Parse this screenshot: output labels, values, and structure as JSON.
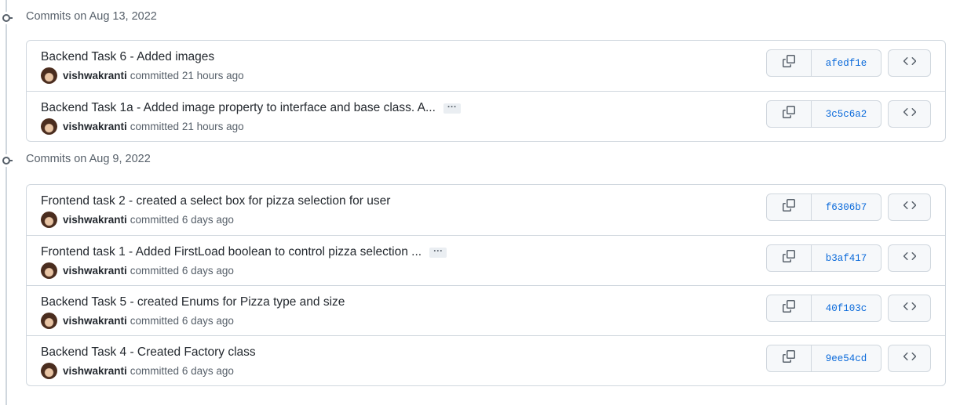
{
  "groups": [
    {
      "title": "Commits on Aug 13, 2022",
      "commits": [
        {
          "message": "Backend Task 6 - Added images",
          "truncated": false,
          "author": "vishwakranti",
          "committed_text": "committed 21 hours ago",
          "sha": "afedf1e"
        },
        {
          "message": "Backend Task 1a - Added image property to interface and base class. A...",
          "truncated": true,
          "ellipsis_label": "···",
          "author": "vishwakranti",
          "committed_text": "committed 21 hours ago",
          "sha": "3c5c6a2"
        }
      ]
    },
    {
      "title": "Commits on Aug 9, 2022",
      "commits": [
        {
          "message": "Frontend task 2 - created a select box for pizza selection for user",
          "truncated": false,
          "author": "vishwakranti",
          "committed_text": "committed 6 days ago",
          "sha": "f6306b7"
        },
        {
          "message": "Frontend task 1 - Added FirstLoad boolean to control pizza selection ...",
          "truncated": true,
          "ellipsis_label": "···",
          "author": "vishwakranti",
          "committed_text": "committed 6 days ago",
          "sha": "b3af417"
        },
        {
          "message": "Backend Task 5 - created Enums for Pizza type and size",
          "truncated": false,
          "author": "vishwakranti",
          "committed_text": "committed 6 days ago",
          "sha": "40f103c"
        },
        {
          "message": "Backend Task 4 - Created Factory class",
          "truncated": false,
          "author": "vishwakranti",
          "committed_text": "committed 6 days ago",
          "sha": "9ee54cd"
        }
      ]
    }
  ],
  "icons": {
    "copy": "copy-icon",
    "browse": "code-icon",
    "node": "git-commit-icon"
  },
  "colors": {
    "sha_link": "#0969da",
    "border": "#d0d7de",
    "muted": "#57606a"
  }
}
